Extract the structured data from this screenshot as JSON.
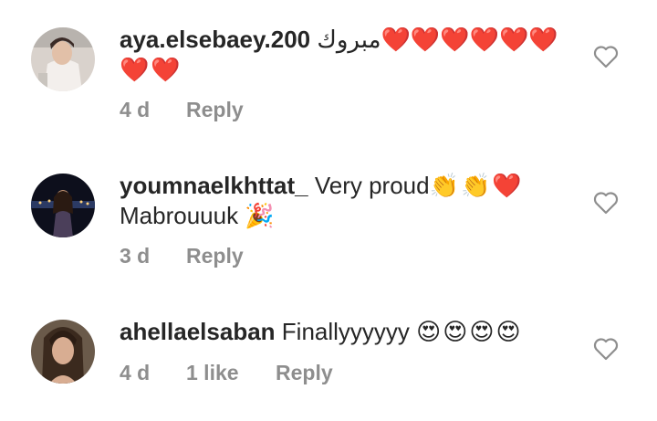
{
  "comments": [
    {
      "username": "aya.elsebaey.200",
      "text": "مبروك",
      "emojis_line1": "❤️❤️❤️❤️❤️❤️",
      "emojis_line2": "❤️❤️",
      "time": "4 d",
      "reply_label": "Reply"
    },
    {
      "username": "youmnaelkhttat_",
      "text": "Very proud",
      "emojis_line1": "👏👏❤️",
      "text_line2": "Mabrouuuk",
      "emojis_line2": "🎉",
      "time": "3 d",
      "reply_label": "Reply"
    },
    {
      "username": "ahellaelsaban",
      "text": "Finallyyyyyy",
      "emojis_line1": "😍😍😍😍",
      "time": "4 d",
      "likes": "1 like",
      "reply_label": "Reply"
    }
  ],
  "icons": {
    "like": "heart-outline-icon"
  },
  "colors": {
    "text": "#262626",
    "meta": "#8e8e8e",
    "heart_outline": "#8e8e8e"
  }
}
